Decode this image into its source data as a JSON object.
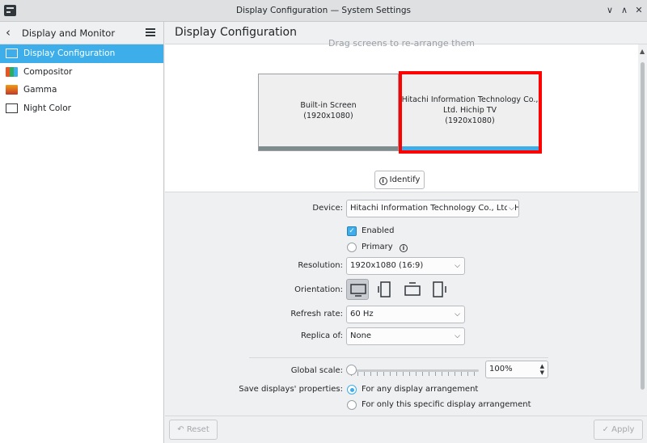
{
  "window": {
    "title": "Display Configuration — System Settings",
    "controls": {
      "minimize": "∨",
      "maximize": "∧",
      "close": "✕"
    }
  },
  "sidebar": {
    "header": {
      "back_icon": "chevron-left-icon",
      "title": "Display and Monitor",
      "menu_icon": "hamburger-menu-icon"
    },
    "items": [
      {
        "label": "Display Configuration",
        "icon": "monitor-icon",
        "active": true
      },
      {
        "label": "Compositor",
        "icon": "compositor-icon",
        "active": false
      },
      {
        "label": "Gamma",
        "icon": "gamma-icon",
        "active": false
      },
      {
        "label": "Night Color",
        "icon": "night-color-icon",
        "active": false
      }
    ]
  },
  "content": {
    "title": "Display Configuration",
    "hint": "Drag screens to re-arrange them",
    "screens": [
      {
        "name": "Built-in Screen",
        "resolution": "(1920x1080)",
        "selected": false
      },
      {
        "name_line1": "Hitachi Information Technology Co.,",
        "name_line2": "Ltd. Hichip TV",
        "resolution": "(1920x1080)",
        "selected": true
      }
    ],
    "identify_label": "Identify",
    "form": {
      "device_label": "Device:",
      "device_value": "Hitachi Information Technology Co., Ltd. Hichip TV",
      "enabled_label": "Enabled",
      "enabled": true,
      "primary_label": "Primary",
      "primary": false,
      "resolution_label": "Resolution:",
      "resolution_value": "1920x1080 (16:9)",
      "orientation_label": "Orientation:",
      "orientation_options": [
        "landscape",
        "portrait-left",
        "landscape-flipped",
        "portrait-right"
      ],
      "orientation_selected": "landscape",
      "refresh_label": "Refresh rate:",
      "refresh_value": "60 Hz",
      "replica_label": "Replica of:",
      "replica_value": "None",
      "scale_label": "Global scale:",
      "scale_value": "100%",
      "scale_fraction": 0,
      "save_label": "Save displays' properties:",
      "save_options": [
        {
          "label": "For any display arrangement",
          "selected": true
        },
        {
          "label": "For only this specific display arrangement",
          "selected": false
        }
      ]
    }
  },
  "footer": {
    "reset_label": "Reset",
    "apply_label": "Apply"
  },
  "colors": {
    "accent": "#3daee9",
    "highlight": "#ff0000"
  }
}
